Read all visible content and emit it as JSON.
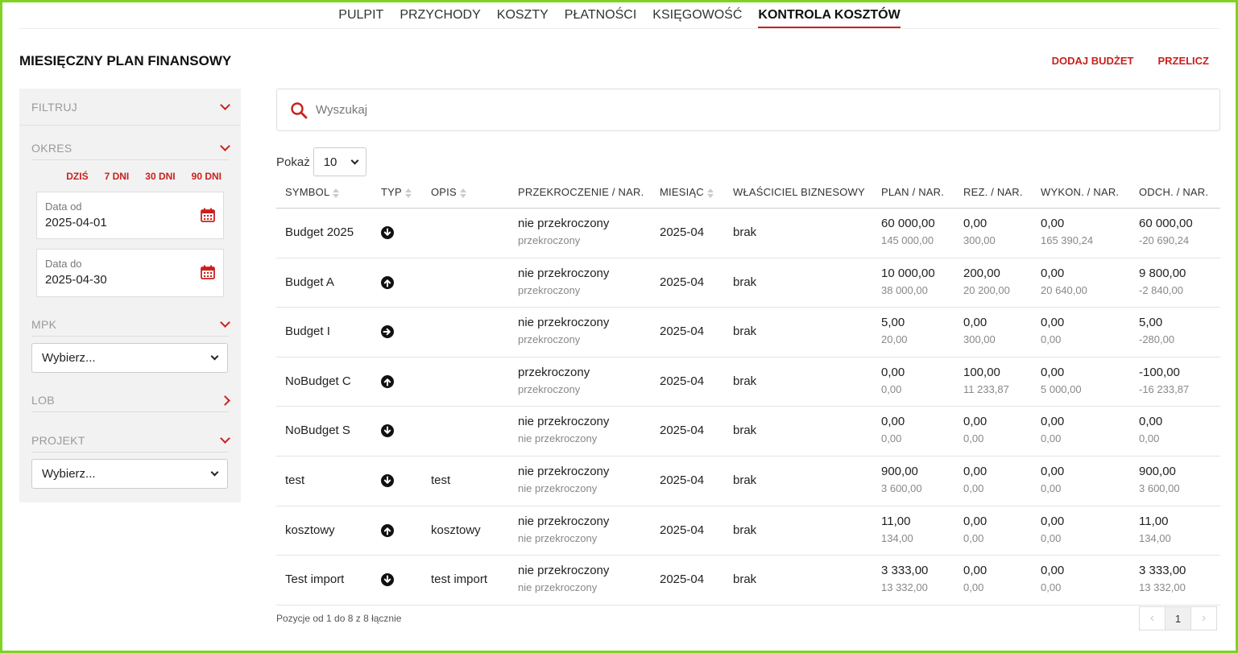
{
  "nav": {
    "items": [
      "PULPIT",
      "PRZYCHODY",
      "KOSZTY",
      "PŁATNOŚCI",
      "KSIĘGOWOŚĆ",
      "KONTROLA KOSZTÓW"
    ],
    "active": "KONTROLA KOSZTÓW"
  },
  "page": {
    "title": "MIESIĘCZNY PLAN FINANSOWY",
    "add_budget": "DODAJ BUDŻET",
    "recalc": "PRZELICZ"
  },
  "sidebar": {
    "filter": "FILTRUJ",
    "period": "OKRES",
    "quick": [
      "DZIŚ",
      "7 DNI",
      "30 DNI",
      "90 DNI"
    ],
    "date_from_label": "Data od",
    "date_from": "2025-04-01",
    "date_to_label": "Data do",
    "date_to": "2025-04-30",
    "mpk": "MPK",
    "mpk_select": "Wybierz...",
    "lob": "LOB",
    "project": "PROJEKT",
    "project_select": "Wybierz..."
  },
  "search": {
    "placeholder": "Wyszukaj"
  },
  "show": {
    "label": "Pokaż",
    "value": "10"
  },
  "table": {
    "headers": {
      "symbol": "SYMBOL",
      "type": "TYP",
      "desc": "OPIS",
      "over": "PRZEKROCZENIE / NAR.",
      "month": "MIESIĄC",
      "owner": "WŁAŚCICIEL BIZNESOWY",
      "plan": "PLAN / NAR.",
      "rez": "REZ. / NAR.",
      "wyk": "WYKON. / NAR.",
      "odch": "ODCH. / NAR."
    },
    "rows": [
      {
        "symbol": "Budget 2025",
        "type": "down",
        "desc": "",
        "over": "nie przekroczony",
        "over_cum": "przekroczony",
        "month": "2025-04",
        "owner": "brak",
        "plan": "60 000,00",
        "plan_cum": "145 000,00",
        "rez": "0,00",
        "rez_cum": "300,00",
        "wyk": "0,00",
        "wyk_cum": "165 390,24",
        "odch": "60 000,00",
        "odch_cum": "-20 690,24"
      },
      {
        "symbol": "Budget A",
        "type": "up",
        "desc": "",
        "over": "nie przekroczony",
        "over_cum": "przekroczony",
        "month": "2025-04",
        "owner": "brak",
        "plan": "10 000,00",
        "plan_cum": "38 000,00",
        "rez": "200,00",
        "rez_cum": "20 200,00",
        "wyk": "0,00",
        "wyk_cum": "20 640,00",
        "odch": "9 800,00",
        "odch_cum": "-2 840,00"
      },
      {
        "symbol": "Budget I",
        "type": "right",
        "desc": "",
        "over": "nie przekroczony",
        "over_cum": "przekroczony",
        "month": "2025-04",
        "owner": "brak",
        "plan": "5,00",
        "plan_cum": "20,00",
        "rez": "0,00",
        "rez_cum": "300,00",
        "wyk": "0,00",
        "wyk_cum": "0,00",
        "odch": "5,00",
        "odch_cum": "-280,00"
      },
      {
        "symbol": "NoBudget C",
        "type": "up",
        "desc": "",
        "over": "przekroczony",
        "over_cum": "przekroczony",
        "month": "2025-04",
        "owner": "brak",
        "plan": "0,00",
        "plan_cum": "0,00",
        "rez": "100,00",
        "rez_cum": "11 233,87",
        "wyk": "0,00",
        "wyk_cum": "5 000,00",
        "odch": "-100,00",
        "odch_cum": "-16 233,87"
      },
      {
        "symbol": "NoBudget S",
        "type": "down",
        "desc": "",
        "over": "nie przekroczony",
        "over_cum": "nie przekroczony",
        "month": "2025-04",
        "owner": "brak",
        "plan": "0,00",
        "plan_cum": "0,00",
        "rez": "0,00",
        "rez_cum": "0,00",
        "wyk": "0,00",
        "wyk_cum": "0,00",
        "odch": "0,00",
        "odch_cum": "0,00"
      },
      {
        "symbol": "test",
        "type": "down",
        "desc": "test",
        "over": "nie przekroczony",
        "over_cum": "nie przekroczony",
        "month": "2025-04",
        "owner": "brak",
        "plan": "900,00",
        "plan_cum": "3 600,00",
        "rez": "0,00",
        "rez_cum": "0,00",
        "wyk": "0,00",
        "wyk_cum": "0,00",
        "odch": "900,00",
        "odch_cum": "3 600,00"
      },
      {
        "symbol": "kosztowy",
        "type": "up",
        "desc": "kosztowy",
        "over": "nie przekroczony",
        "over_cum": "nie przekroczony",
        "month": "2025-04",
        "owner": "brak",
        "plan": "11,00",
        "plan_cum": "134,00",
        "rez": "0,00",
        "rez_cum": "0,00",
        "wyk": "0,00",
        "wyk_cum": "0,00",
        "odch": "11,00",
        "odch_cum": "134,00"
      },
      {
        "symbol": "Test import",
        "type": "down",
        "desc": "test import",
        "over": "nie przekroczony",
        "over_cum": "nie przekroczony",
        "month": "2025-04",
        "owner": "brak",
        "plan": "3 333,00",
        "plan_cum": "13 332,00",
        "rez": "0,00",
        "rez_cum": "0,00",
        "wyk": "0,00",
        "wyk_cum": "0,00",
        "odch": "3 333,00",
        "odch_cum": "13 332,00"
      }
    ]
  },
  "footer": {
    "info": "Pozycje od 1 do 8 z 8 łącznie",
    "page": "1",
    "prev": "‹",
    "next": "›"
  },
  "colors": {
    "accent": "#c9211e",
    "frame": "#7ed321"
  }
}
